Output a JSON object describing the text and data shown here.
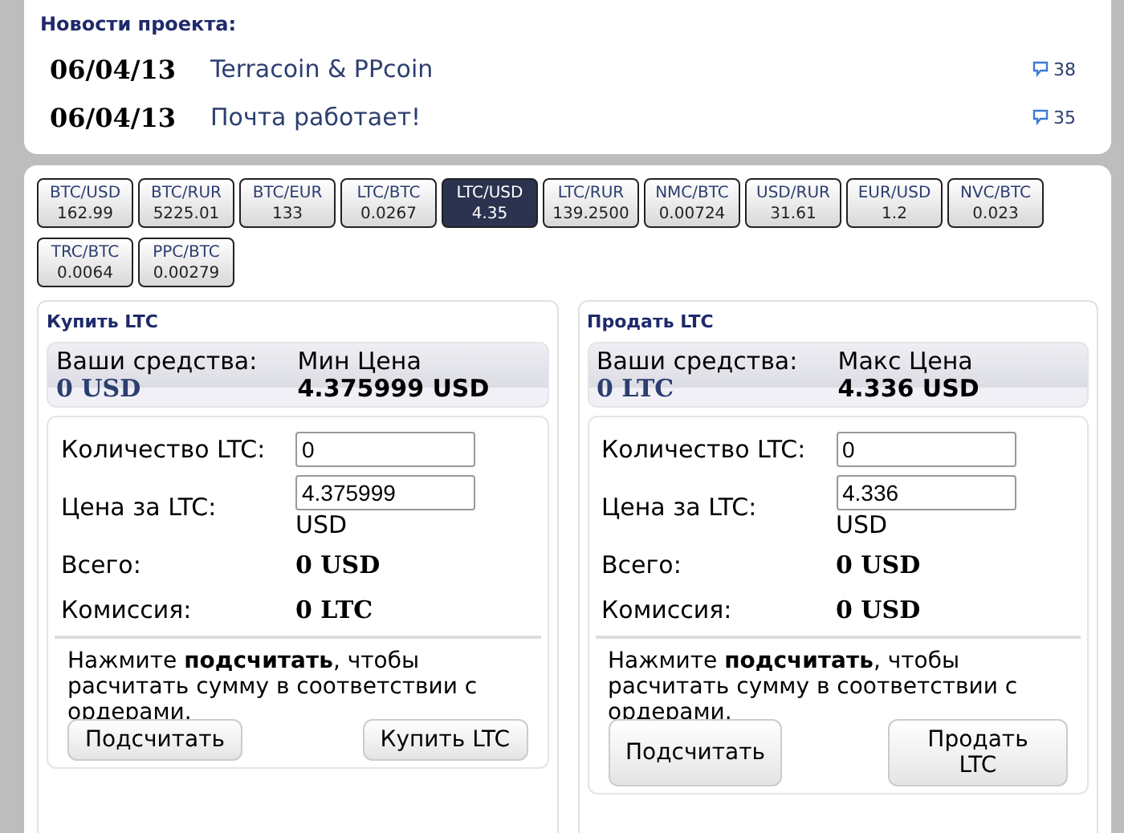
{
  "news": {
    "title": "Новости проекта:",
    "items": [
      {
        "date": "06/04/13",
        "title": "Terracoin & PPcoin",
        "comments": "38"
      },
      {
        "date": "06/04/13",
        "title": "Почта работает!",
        "comments": "35"
      }
    ]
  },
  "pairs": [
    {
      "pair": "BTC/USD",
      "price": "162.99",
      "selected": false
    },
    {
      "pair": "BTC/RUR",
      "price": "5225.01",
      "selected": false
    },
    {
      "pair": "BTC/EUR",
      "price": "133",
      "selected": false
    },
    {
      "pair": "LTC/BTC",
      "price": "0.0267",
      "selected": false
    },
    {
      "pair": "LTC/USD",
      "price": "4.35",
      "selected": true
    },
    {
      "pair": "LTC/RUR",
      "price": "139.2500",
      "selected": false
    },
    {
      "pair": "NMC/BTC",
      "price": "0.00724",
      "selected": false
    },
    {
      "pair": "USD/RUR",
      "price": "31.61",
      "selected": false
    },
    {
      "pair": "EUR/USD",
      "price": "1.2",
      "selected": false
    },
    {
      "pair": "NVC/BTC",
      "price": "0.023",
      "selected": false
    },
    {
      "pair": "TRC/BTC",
      "price": "0.0064",
      "selected": false
    },
    {
      "pair": "PPC/BTC",
      "price": "0.00279",
      "selected": false
    }
  ],
  "panels": [
    {
      "title": "Купить LTC",
      "funds_label": "Ваши средства:",
      "funds_value": "0 USD",
      "price_label": "Мин Цена",
      "price_value": "4.375999 USD",
      "amount_label": "Количество LTC:",
      "amount_value": "0",
      "price_field_label": "Цена за LTC:",
      "price_field_value": "4.375999",
      "price_unit": "USD",
      "totals": [
        {
          "label": "Всего:",
          "value": "0 USD"
        },
        {
          "label": "Комиссия:",
          "value": "0 LTC"
        }
      ],
      "hint": "Нажмите **подсчитать**, чтобы расчитать сумму в соответствии с ордерами.",
      "buttons": [
        "Подсчитать",
        "Купить LTC"
      ]
    },
    {
      "title": "Продать LTC",
      "funds_label": "Ваши средства:",
      "funds_value": "0 LTC",
      "price_label": "Макс Цена",
      "price_value": "4.336 USD",
      "amount_label": "Количество LTC:",
      "amount_value": "0",
      "price_field_label": "Цена за LTC:",
      "price_field_value": "4.336",
      "price_unit": "USD",
      "totals": [
        {
          "label": "Всего:",
          "value": "0 USD"
        },
        {
          "label": "Комиссия:",
          "value": "0 USD"
        }
      ],
      "hint": "Нажмите **подсчитать**, чтобы расчитать сумму в соответствии с ордерами.",
      "buttons": [
        "Подсчитать",
        "Продать LTC"
      ]
    }
  ]
}
